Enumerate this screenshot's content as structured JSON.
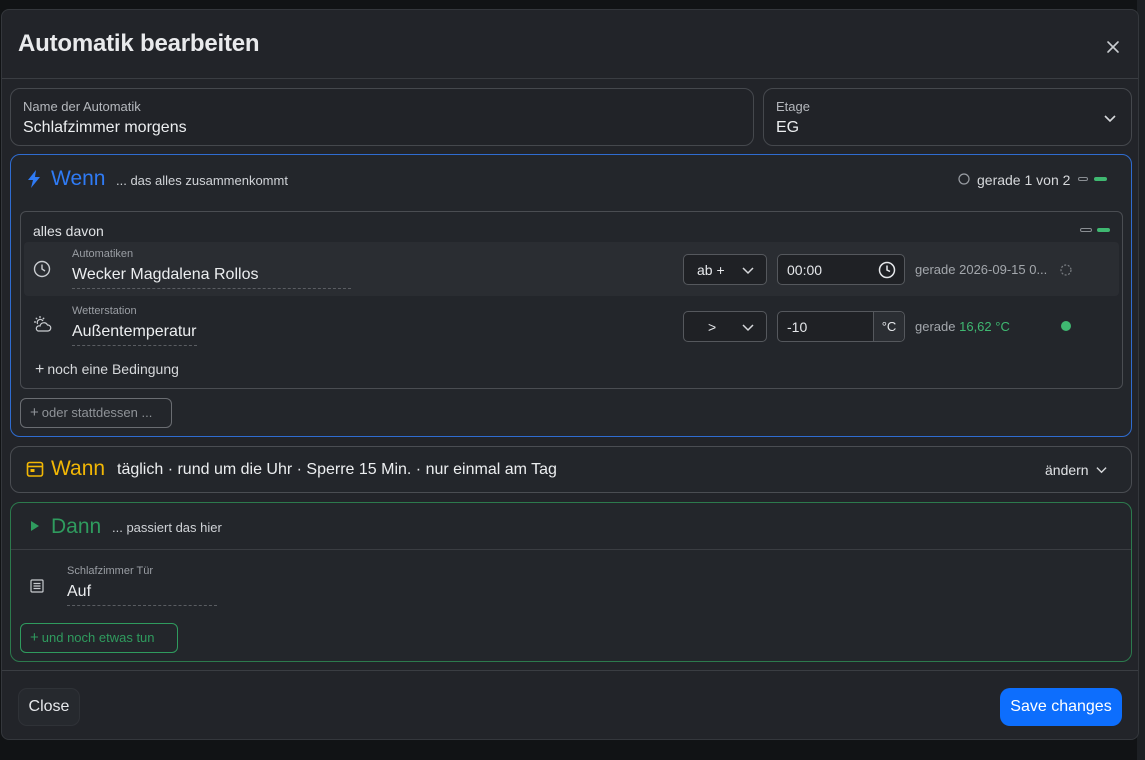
{
  "modal": {
    "title": "Automatik bearbeiten"
  },
  "fields": {
    "name": {
      "label": "Name der Automatik",
      "value": "Schlafzimmer morgens"
    },
    "floor": {
      "label": "Etage",
      "value": "EG"
    }
  },
  "wenn": {
    "title": "Wenn",
    "subtitle": "... das alles zusammenkommt",
    "status": "gerade 1 von 2",
    "group_label": "alles davon",
    "conditions": [
      {
        "category": "Automatiken",
        "name": "Wecker Magdalena Rollos",
        "operator": "ab +",
        "value": "00:00",
        "state_prefix": "gerade",
        "state_value": "2026-09-15 0..."
      },
      {
        "category": "Wetterstation",
        "name": "Außentemperatur",
        "operator": ">",
        "value": "-10",
        "unit": "°C",
        "state_prefix": "gerade",
        "state_value": "16,62 °C"
      }
    ],
    "add_condition": "noch eine Bedingung",
    "add_alternative": "oder stattdessen ..."
  },
  "wann": {
    "title": "Wann",
    "summary": "täglich · rund um die Uhr · Sperre 15 Min. · nur einmal am Tag",
    "change_label": "ändern"
  },
  "dann": {
    "title": "Dann",
    "subtitle": "... passiert das hier",
    "actions": [
      {
        "category": "Schlafzimmer Tür",
        "value": "Auf"
      }
    ],
    "add_action": "und noch etwas tun"
  },
  "footer": {
    "close_label": "Close",
    "save_label": "Save changes"
  },
  "colors": {
    "wenn_accent": "#2f7bf5",
    "wann_accent": "#f2b705",
    "dann_accent": "#2f9b5e",
    "primary_button": "#0d6efd",
    "ok_state": "#3fb871"
  },
  "icons": {
    "close": "close-icon",
    "wenn": "lightning-icon",
    "wann": "calendar-icon",
    "dann": "play-icon",
    "clock": "clock-icon",
    "weather": "sun-cloud-icon",
    "action": "list-icon"
  }
}
